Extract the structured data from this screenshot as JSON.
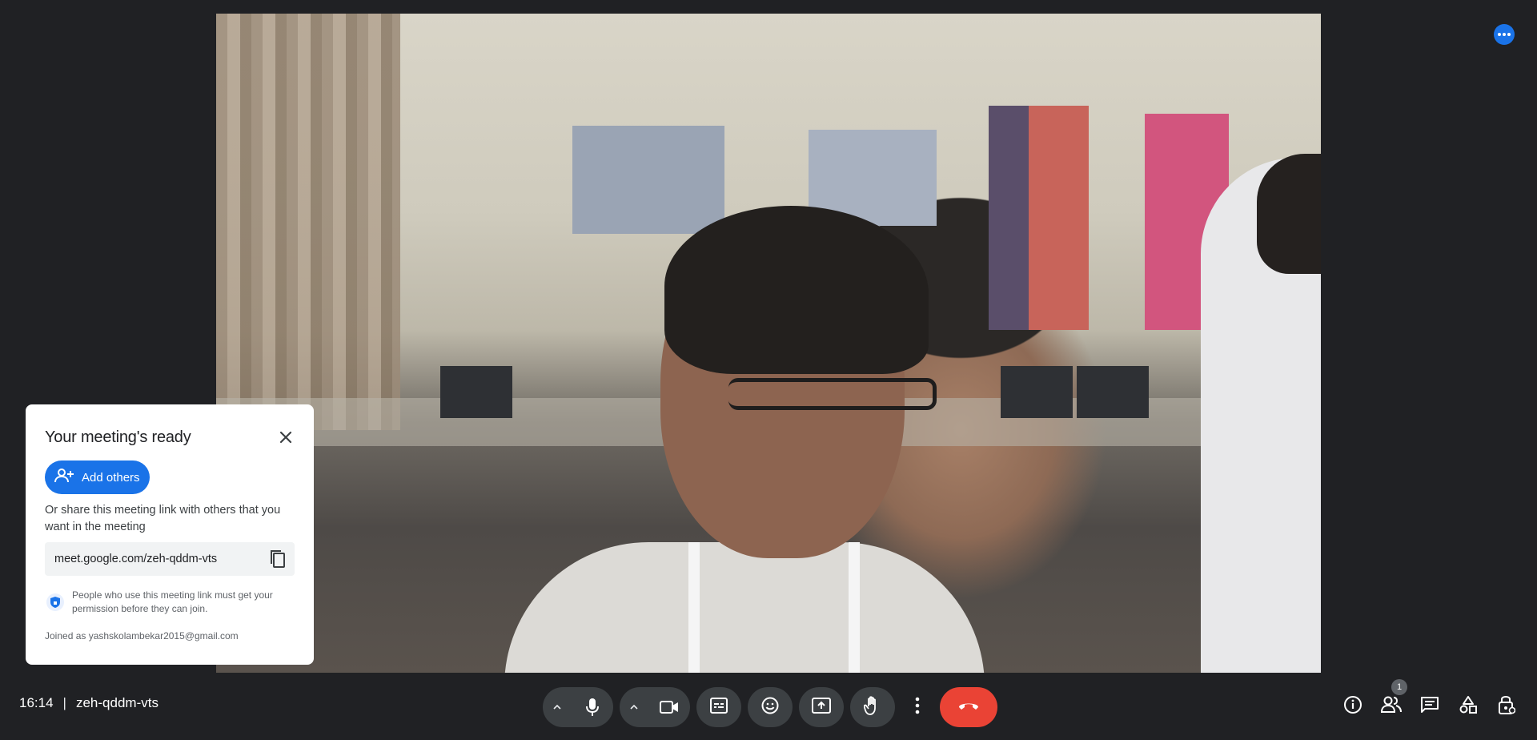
{
  "card": {
    "title": "Your meeting's ready",
    "add_others_label": "Add others",
    "share_text": "Or share this meeting link with others that you want in the meeting",
    "meeting_link": "meet.google.com/zeh-qddm-vts",
    "permission_text": "People who use this meeting link must get your permission before they can join.",
    "joined_as": "Joined as yashskolambekar2015@gmail.com"
  },
  "bottom": {
    "time": "16:14",
    "separator": "|",
    "meeting_code": "zeh-qddm-vts",
    "participants_count": "1"
  },
  "icons": {
    "more": "more-options-icon",
    "close": "close-icon",
    "add_person": "person-add-icon",
    "copy": "copy-icon",
    "shield": "lock-shield-icon",
    "mic": "microphone-icon",
    "camera": "video-camera-icon",
    "captions": "captions-icon",
    "emoji": "emoji-icon",
    "present": "present-screen-icon",
    "hand": "raise-hand-icon",
    "more_vert": "more-vert-icon",
    "end_call": "end-call-icon",
    "info": "info-icon",
    "people": "people-icon",
    "chat": "chat-icon",
    "activities": "activities-icon",
    "host_controls": "host-controls-lock-icon"
  },
  "colors": {
    "background": "#202124",
    "accent": "#1a73e8",
    "end_call": "#ea4335",
    "control_bg": "#3c4043"
  }
}
